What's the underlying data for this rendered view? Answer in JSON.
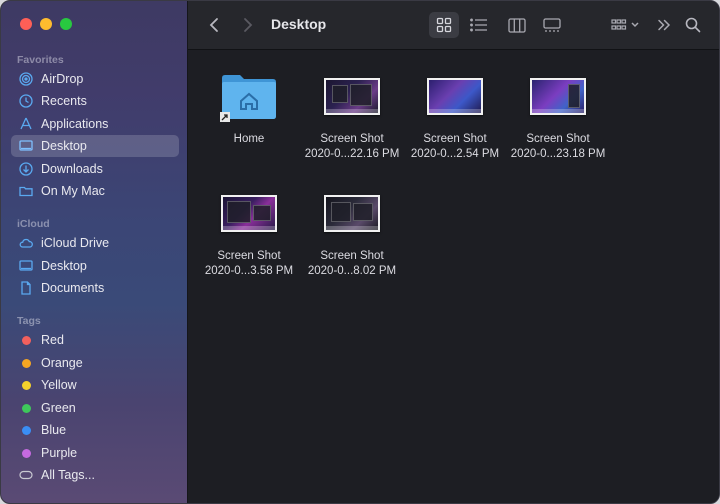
{
  "window": {
    "title": "Desktop"
  },
  "sidebar": {
    "favorites_title": "Favorites",
    "favorites": [
      {
        "label": "AirDrop",
        "icon": "airdrop-icon"
      },
      {
        "label": "Recents",
        "icon": "clock-icon"
      },
      {
        "label": "Applications",
        "icon": "applications-icon"
      },
      {
        "label": "Desktop",
        "icon": "desktop-icon",
        "selected": true
      },
      {
        "label": "Downloads",
        "icon": "downloads-icon"
      },
      {
        "label": "On My Mac",
        "icon": "folder-icon"
      }
    ],
    "icloud_title": "iCloud",
    "icloud": [
      {
        "label": "iCloud Drive",
        "icon": "cloud-icon"
      },
      {
        "label": "Desktop",
        "icon": "desktop-icon"
      },
      {
        "label": "Documents",
        "icon": "document-icon"
      }
    ],
    "tags_title": "Tags",
    "tags": [
      {
        "label": "Red",
        "color": "#f2605d"
      },
      {
        "label": "Orange",
        "color": "#f5a623"
      },
      {
        "label": "Yellow",
        "color": "#f4d22c"
      },
      {
        "label": "Green",
        "color": "#3ec85b"
      },
      {
        "label": "Blue",
        "color": "#3a8ef5"
      },
      {
        "label": "Purple",
        "color": "#c56ae0"
      },
      {
        "label": "All Tags...",
        "icon": "all-tags-icon"
      }
    ]
  },
  "toolbar": {
    "back_icon": "chevron-left-icon",
    "forward_icon": "chevron-right-icon",
    "views": [
      "icon-view-icon",
      "list-view-icon",
      "column-view-icon",
      "gallery-view-icon"
    ],
    "active_view": "icon-view-icon",
    "group_icon": "group-by-icon",
    "more_icon": "double-chevron-icon",
    "search_icon": "search-icon"
  },
  "files": [
    {
      "name1": "Home",
      "name2": "",
      "kind": "folder"
    },
    {
      "name1": "Screen Shot",
      "name2": "2020-0...22.16 PM",
      "kind": "screenshot"
    },
    {
      "name1": "Screen Shot",
      "name2": "2020-0...2.54 PM",
      "kind": "screenshot"
    },
    {
      "name1": "Screen Shot",
      "name2": "2020-0...23.18 PM",
      "kind": "screenshot"
    },
    {
      "name1": "Screen Shot",
      "name2": "2020-0...3.58 PM",
      "kind": "screenshot"
    },
    {
      "name1": "Screen Shot",
      "name2": "2020-0...8.02 PM",
      "kind": "screenshot"
    }
  ],
  "colors": {
    "folder": "#5fb4ee",
    "selection": "rgba(255,255,255,0.17)",
    "close": "#fe5f57",
    "minimize": "#febc2e",
    "zoom": "#28c840"
  }
}
